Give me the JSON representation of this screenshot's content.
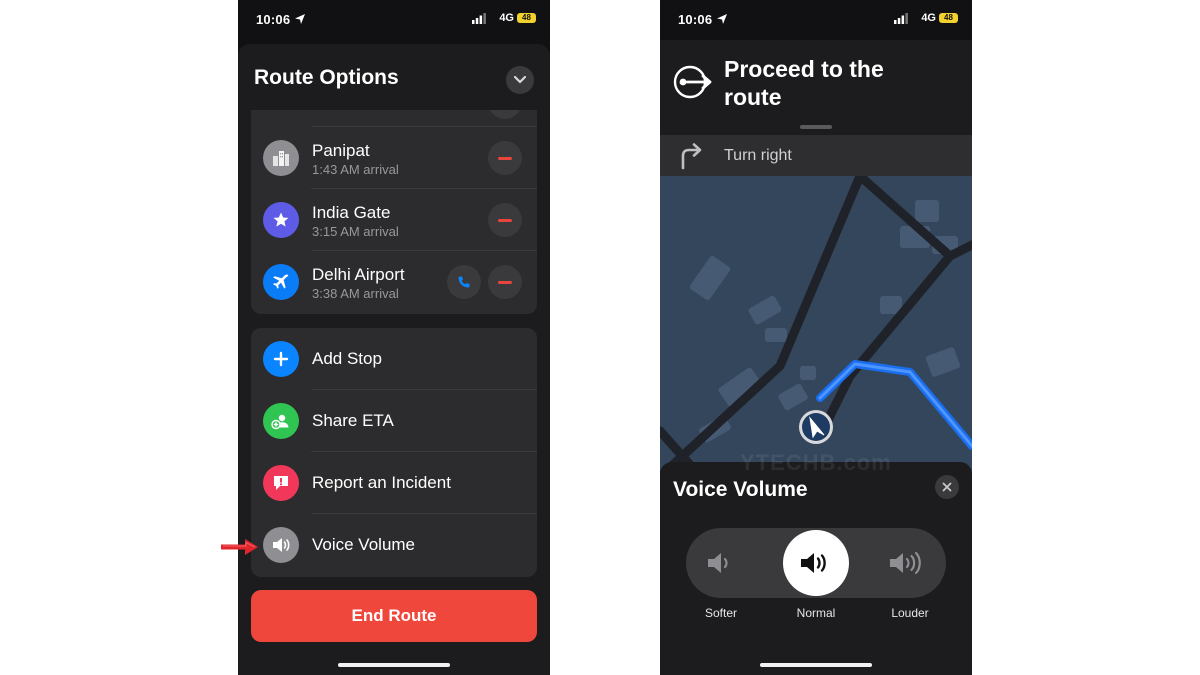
{
  "status_bar": {
    "time": "10:06",
    "network": "4G",
    "battery": "48"
  },
  "route_options": {
    "title": "Route Options",
    "stops": [
      {
        "name": "Panipat",
        "arrival": "1:43 AM arrival",
        "icon": "city-icon"
      },
      {
        "name": "India Gate",
        "arrival": "3:15 AM arrival",
        "icon": "star-icon"
      },
      {
        "name": "Delhi Airport",
        "arrival": "3:38 AM arrival",
        "icon": "airplane-icon"
      }
    ],
    "actions": [
      {
        "label": "Add Stop",
        "icon": "plus-icon",
        "color": "#0a84ff"
      },
      {
        "label": "Share ETA",
        "icon": "share-eta-icon",
        "color": "#30c552"
      },
      {
        "label": "Report an Incident",
        "icon": "report-icon",
        "color": "#f2385a"
      },
      {
        "label": "Voice Volume",
        "icon": "speaker-icon",
        "color": "#8e8e93"
      }
    ],
    "end_route_label": "End Route"
  },
  "navigation": {
    "instruction": "Proceed to the route",
    "next_instruction": "Turn right"
  },
  "watermark": "YTECHB.com",
  "voice_volume": {
    "title": "Voice Volume",
    "options": [
      "Softer",
      "Normal",
      "Louder"
    ],
    "selected": "Normal"
  },
  "colors": {
    "accent_blue": "#0a84ff",
    "end_route_red": "#f0473c",
    "route_line_blue": "#1d73f2",
    "map_block": "#3a4a5e",
    "battery_yellow": "#f1d12e"
  }
}
